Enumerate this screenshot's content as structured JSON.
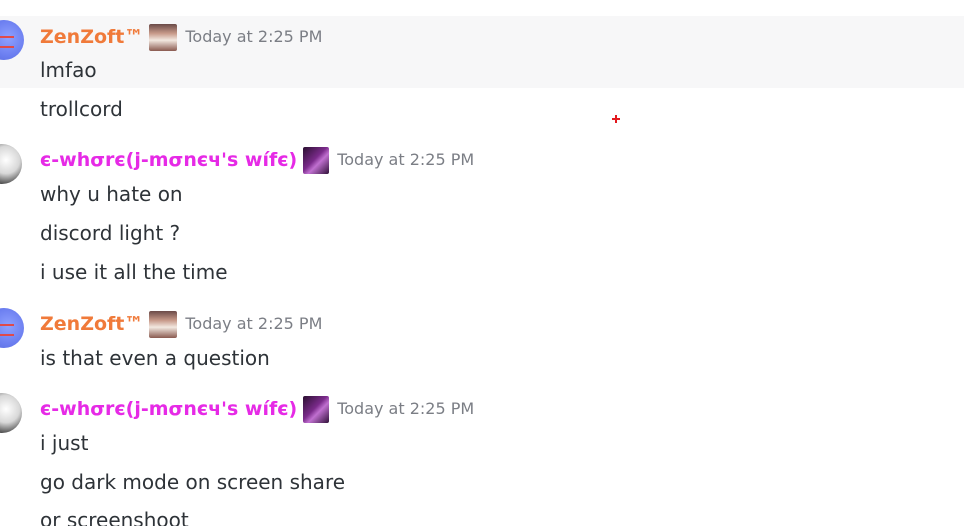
{
  "groups": [
    {
      "author": "ZenZoft™",
      "timestamp": "Today at 2:25 PM",
      "messages": [
        "lmfao",
        "trollcord"
      ]
    },
    {
      "author": "є-whσrє(j-mσnєч's wífє)",
      "timestamp": "Today at 2:25 PM",
      "messages": [
        "why u hate on",
        "discord light ?",
        "i use it all the time"
      ]
    },
    {
      "author": "ZenZoft™",
      "timestamp": "Today at 2:25 PM",
      "messages": [
        "is that even a question"
      ]
    },
    {
      "author": "є-whσrє(j-mσnєч's wífє)",
      "timestamp": "Today at 2:25 PM",
      "messages": [
        "i just",
        "go dark mode on screen share",
        "or screenshoot"
      ]
    }
  ],
  "colors": {
    "zenzoft_name": "#f07a3a",
    "ewhore_name": "#e62ae6",
    "timestamp": "#7b7e85",
    "message_text": "#2e3338",
    "hover_band": "#f7f7f8"
  },
  "icons": {
    "avatar_zenzoft": "user-avatar",
    "avatar_ewhore": "user-avatar",
    "badge_zenzoft": "face-emoji-badge",
    "badge_ewhore": "profile-image-badge"
  }
}
